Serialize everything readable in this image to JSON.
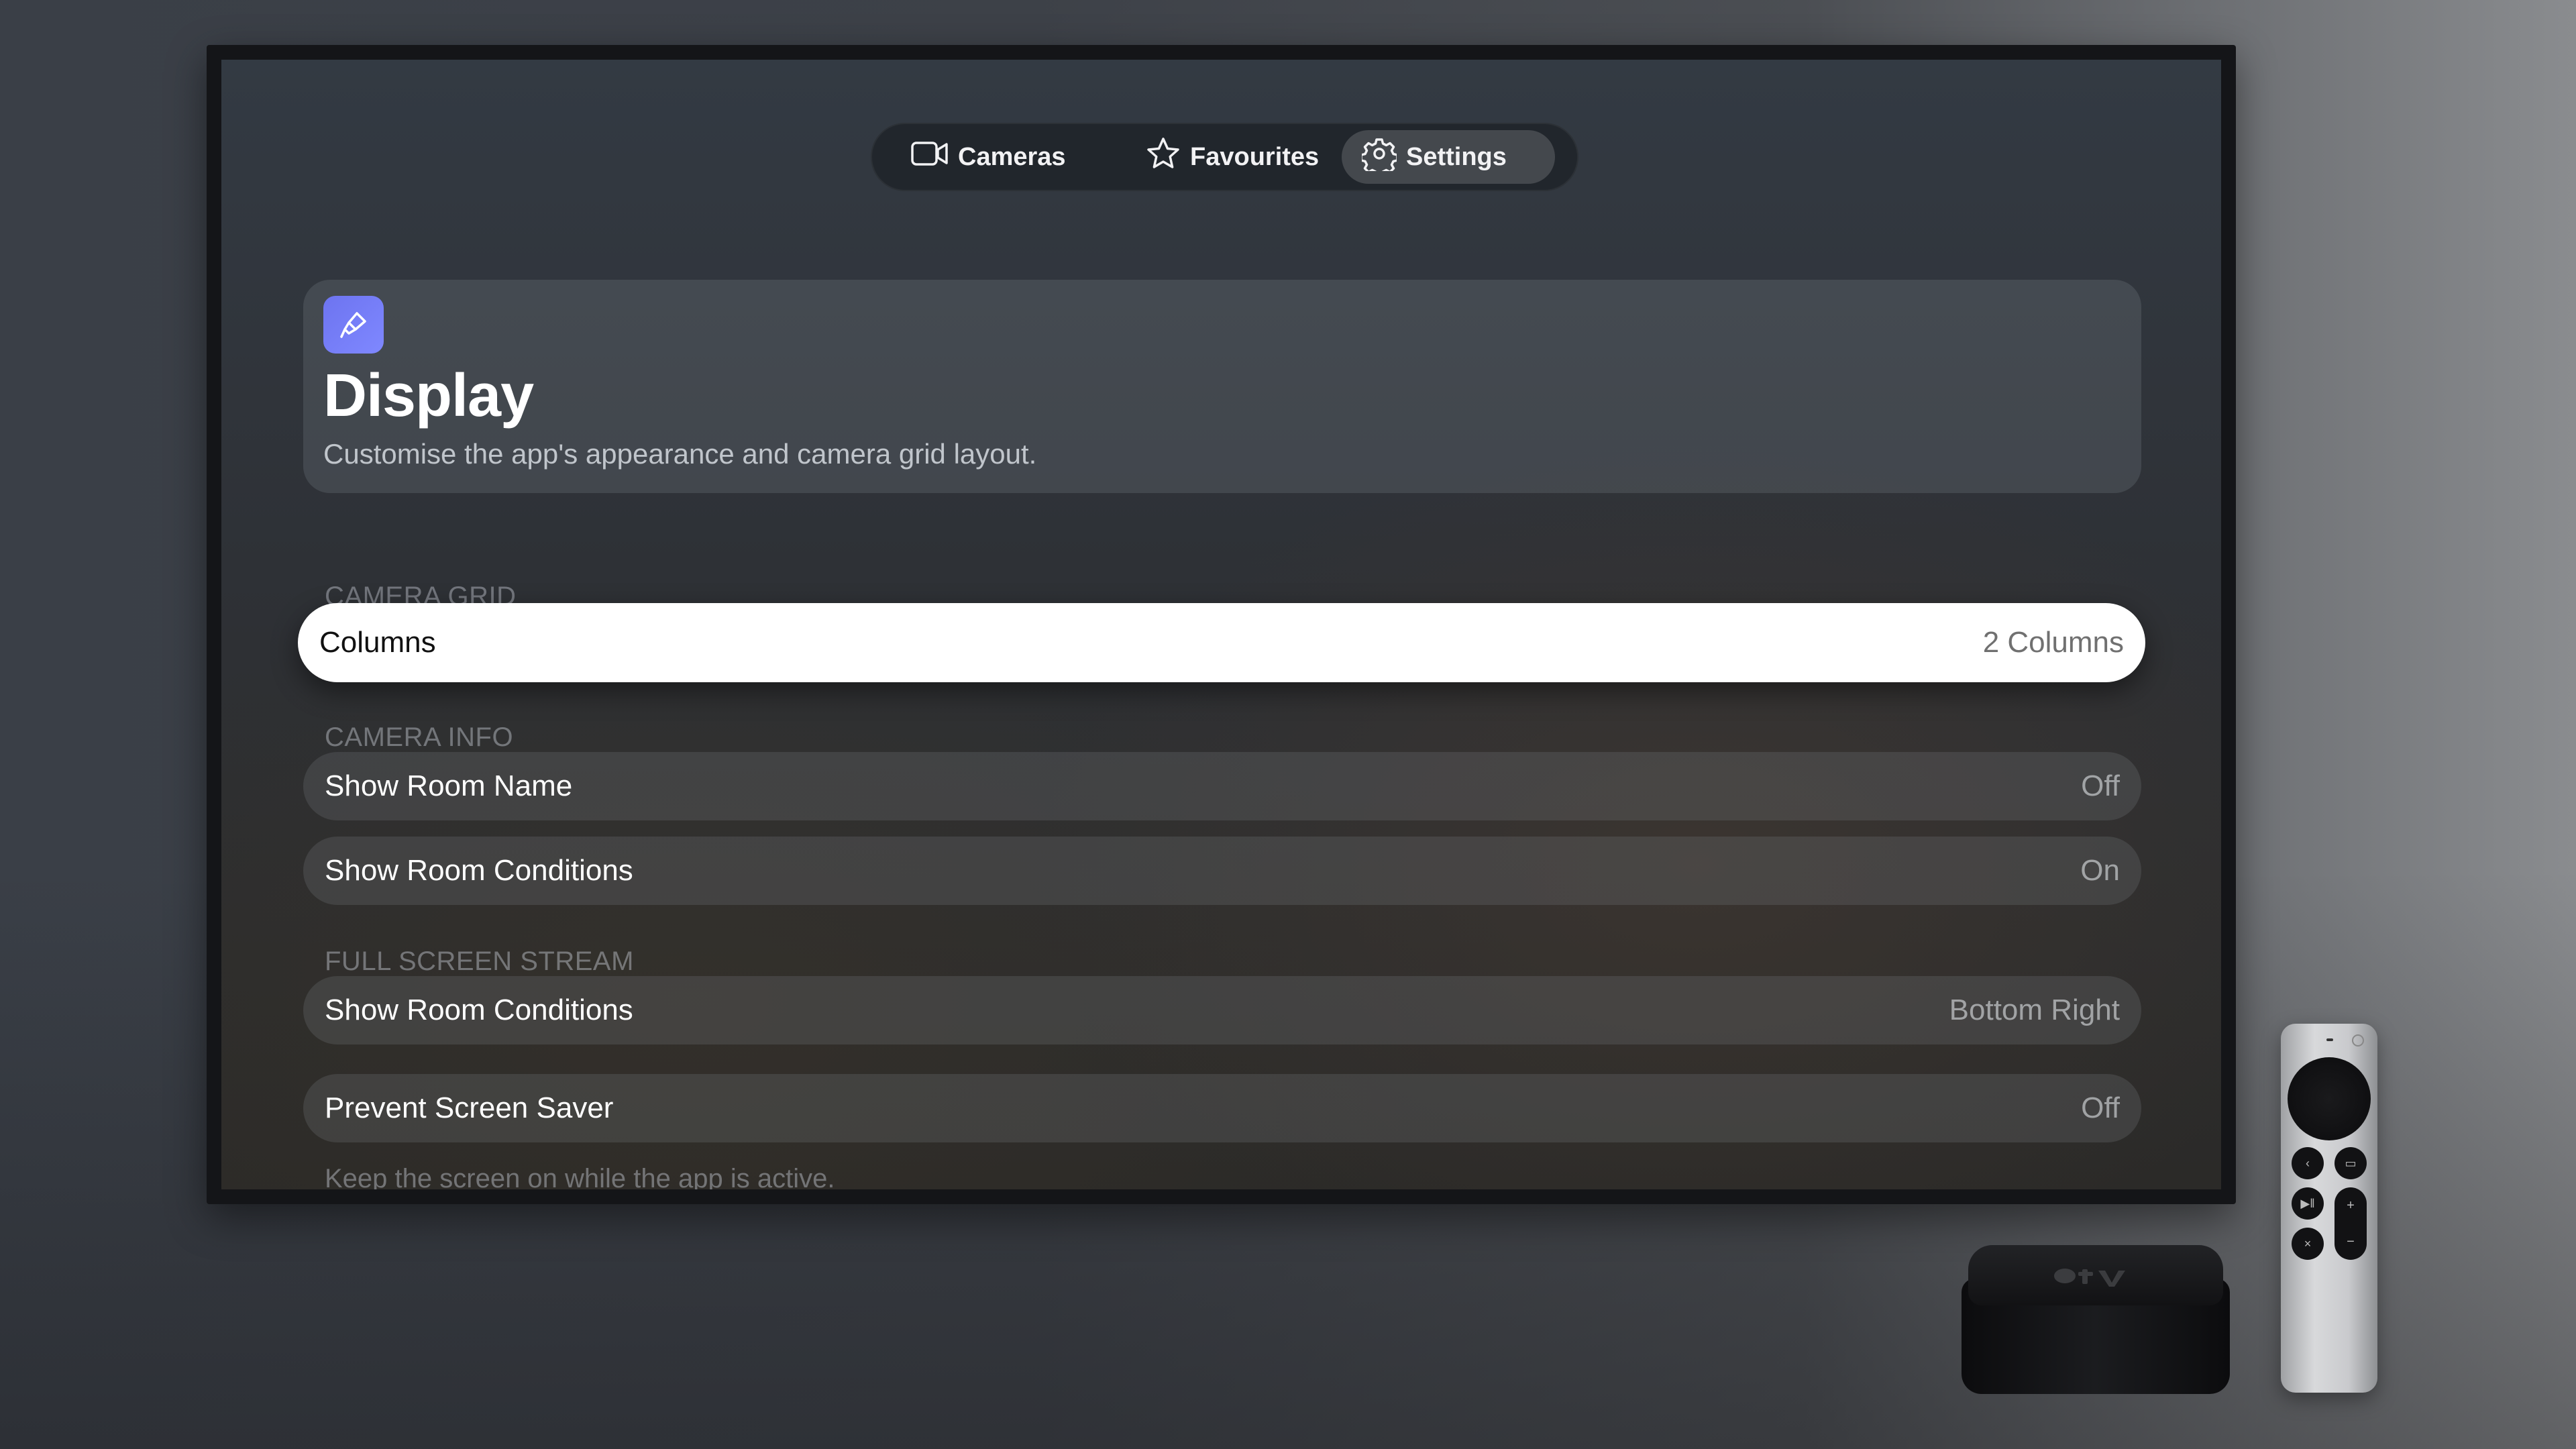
{
  "tabs": [
    {
      "label": "Cameras",
      "icon": "video-camera-icon"
    },
    {
      "label": "Favourites",
      "icon": "star-icon"
    },
    {
      "label": "Settings",
      "icon": "gear-icon",
      "selected": true
    }
  ],
  "header": {
    "icon": "paintbrush-icon",
    "icon_color": "#7178f5",
    "title": "Display",
    "subtitle": "Customise the app's appearance and camera grid layout."
  },
  "sections": {
    "camera_grid": {
      "title": "CAMERA GRID",
      "rows": [
        {
          "label": "Columns",
          "value": "2 Columns",
          "focused": true
        }
      ]
    },
    "camera_info": {
      "title": "CAMERA INFO",
      "rows": [
        {
          "label": "Show Room Name",
          "value": "Off"
        },
        {
          "label": "Show Room Conditions",
          "value": "On"
        }
      ]
    },
    "full_screen_stream": {
      "title": "FULL SCREEN STREAM",
      "rows": [
        {
          "label": "Show Room Conditions",
          "value": "Bottom Right"
        }
      ]
    },
    "screen_saver": {
      "rows": [
        {
          "label": "Prevent Screen Saver",
          "value": "Off"
        }
      ],
      "footnote": "Keep the screen on while the app is active."
    }
  },
  "device": {
    "box_icon": "apple-tv-box",
    "remote_icon": "siri-remote"
  }
}
